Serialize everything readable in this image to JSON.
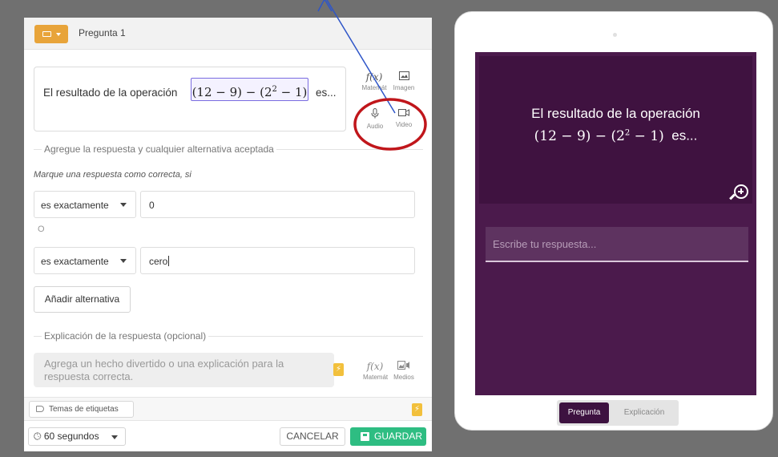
{
  "editor": {
    "question_title": "Pregunta 1",
    "question_text": "El resultado de la operación",
    "math_a": "(12 − 9) − (2",
    "math_exp": "2",
    "math_b": " − 1)",
    "question_suffix": "es...",
    "tools": [
      {
        "label": "Matemát",
        "icon": "f(x)"
      },
      {
        "label": "Imagen",
        "icon": "image-icon"
      },
      {
        "label": "Audio",
        "icon": "microphone-icon"
      },
      {
        "label": "Video",
        "icon": "video-icon"
      }
    ],
    "answers_section_label": "Agregue la respuesta y cualquier alternativa aceptada",
    "mark_hint": "Marque una respuesta como correcta, si",
    "answers": [
      {
        "condition": "es exactamente",
        "value": "0"
      },
      {
        "condition": "es exactamente",
        "value": "cero"
      }
    ],
    "or_label": "O",
    "add_alternative": "Añadir alternativa",
    "explanation_section_label": "Explicación de la respuesta (opcional)",
    "explanation_placeholder": "Agrega un hecho divertido o una explicación para la respuesta correcta.",
    "explanation_tools": [
      {
        "label": "Matemát",
        "icon": "f(x)"
      },
      {
        "label": "Medios",
        "icon": "media-icon"
      }
    ],
    "tags_label": "Temas de etiquetas",
    "timer": "60 segundos",
    "cancel": "CANCELAR",
    "save": "GUARDAR"
  },
  "preview": {
    "question_line1": "El resultado de la operación",
    "math_a": "(12 − 9) − (2",
    "math_exp": "2",
    "math_b": " − 1)",
    "question_suffix": "es...",
    "answer_placeholder": "Escribe tu respuesta...",
    "tabs": [
      {
        "label": "Pregunta",
        "active": true
      },
      {
        "label": "Explicación",
        "active": false
      }
    ]
  },
  "colors": {
    "accent": "#e8a43a",
    "save": "#2ebd82",
    "preview_bg": "#4b1a4c",
    "annotation": "#c0161b"
  }
}
